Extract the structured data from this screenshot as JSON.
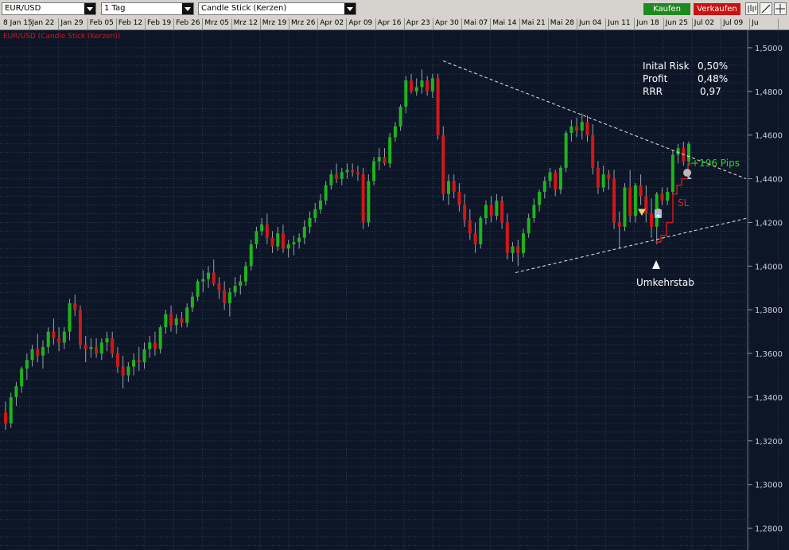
{
  "toolbar": {
    "symbol": "EUR/USD",
    "timeframe": "1 Tag",
    "chart_type": "Candle Stick (Kerzen)",
    "buy_label": "Kaufen",
    "sell_label": "Verkaufen",
    "buy_color": "#1f8a1f",
    "sell_color": "#cc1111",
    "tools": [
      "bar-chart-icon",
      "line-draw-icon",
      "crosshair-icon"
    ]
  },
  "date_axis": [
    "8 Jan 15",
    "Jan 22",
    "Jan 29",
    "Feb 05",
    "Feb 12",
    "Feb 19",
    "Feb 26",
    "Mrz 05",
    "Mrz 12",
    "Mrz 19",
    "Mrz 26",
    "Apr 02",
    "Apr 09",
    "Apr 16",
    "Apr 23",
    "Apr 30",
    "Mai 07",
    "Mai 14",
    "Mai 21",
    "Mai 28",
    "Jun 04",
    "Jun 11",
    "Jun 18",
    "Jun 25",
    "Jul 02",
    "Jul 09",
    "Ju"
  ],
  "chart_data": {
    "type": "candlestick",
    "legend": "EUR/USD (Candle Stick (Kerzen))",
    "y_ticks": [
      "1,5000",
      "1,4800",
      "1,4600",
      "1,4400",
      "1,4200",
      "1,4000",
      "1,3800",
      "1,3600",
      "1,3400",
      "1,3200",
      "1,3000",
      "1,2800"
    ],
    "ylim": [
      1.27,
      1.508
    ],
    "grid": true,
    "colors": {
      "up": "#1cb51c",
      "down": "#d01818",
      "background": "#0d1627",
      "grid": "#2e3a55"
    },
    "candles": [
      [
        1.333,
        1.338,
        1.325,
        1.328
      ],
      [
        1.328,
        1.342,
        1.326,
        1.34
      ],
      [
        1.34,
        1.347,
        1.336,
        1.345
      ],
      [
        1.345,
        1.354,
        1.342,
        1.353
      ],
      [
        1.353,
        1.36,
        1.348,
        1.357
      ],
      [
        1.357,
        1.364,
        1.354,
        1.362
      ],
      [
        1.362,
        1.369,
        1.356,
        1.359
      ],
      [
        1.359,
        1.366,
        1.353,
        1.363
      ],
      [
        1.363,
        1.372,
        1.36,
        1.37
      ],
      [
        1.37,
        1.376,
        1.364,
        1.367
      ],
      [
        1.367,
        1.372,
        1.361,
        1.365
      ],
      [
        1.365,
        1.372,
        1.362,
        1.37
      ],
      [
        1.37,
        1.385,
        1.366,
        1.383
      ],
      [
        1.383,
        1.387,
        1.377,
        1.38
      ],
      [
        1.38,
        1.382,
        1.362,
        1.364
      ],
      [
        1.364,
        1.368,
        1.356,
        1.362
      ],
      [
        1.362,
        1.367,
        1.358,
        1.363
      ],
      [
        1.363,
        1.367,
        1.358,
        1.36
      ],
      [
        1.36,
        1.367,
        1.357,
        1.365
      ],
      [
        1.365,
        1.37,
        1.361,
        1.367
      ],
      [
        1.367,
        1.37,
        1.358,
        1.36
      ],
      [
        1.36,
        1.363,
        1.351,
        1.354
      ],
      [
        1.354,
        1.359,
        1.344,
        1.35
      ],
      [
        1.35,
        1.356,
        1.347,
        1.354
      ],
      [
        1.354,
        1.36,
        1.35,
        1.357
      ],
      [
        1.357,
        1.363,
        1.352,
        1.356
      ],
      [
        1.356,
        1.365,
        1.353,
        1.362
      ],
      [
        1.362,
        1.368,
        1.358,
        1.365
      ],
      [
        1.365,
        1.37,
        1.359,
        1.362
      ],
      [
        1.362,
        1.373,
        1.36,
        1.372
      ],
      [
        1.372,
        1.38,
        1.369,
        1.378
      ],
      [
        1.378,
        1.382,
        1.37,
        1.373
      ],
      [
        1.373,
        1.378,
        1.369,
        1.376
      ],
      [
        1.376,
        1.379,
        1.372,
        1.374
      ],
      [
        1.374,
        1.383,
        1.372,
        1.381
      ],
      [
        1.381,
        1.388,
        1.379,
        1.386
      ],
      [
        1.386,
        1.394,
        1.384,
        1.393
      ],
      [
        1.393,
        1.398,
        1.388,
        1.394
      ],
      [
        1.394,
        1.4,
        1.39,
        1.397
      ],
      [
        1.397,
        1.403,
        1.391,
        1.392
      ],
      [
        1.392,
        1.395,
        1.385,
        1.389
      ],
      [
        1.389,
        1.393,
        1.38,
        1.383
      ],
      [
        1.383,
        1.39,
        1.377,
        1.388
      ],
      [
        1.388,
        1.395,
        1.386,
        1.391
      ],
      [
        1.391,
        1.396,
        1.387,
        1.393
      ],
      [
        1.393,
        1.402,
        1.391,
        1.4
      ],
      [
        1.4,
        1.412,
        1.398,
        1.41
      ],
      [
        1.41,
        1.418,
        1.408,
        1.416
      ],
      [
        1.416,
        1.422,
        1.414,
        1.419
      ],
      [
        1.419,
        1.424,
        1.41,
        1.413
      ],
      [
        1.413,
        1.416,
        1.406,
        1.409
      ],
      [
        1.409,
        1.418,
        1.407,
        1.415
      ],
      [
        1.415,
        1.419,
        1.406,
        1.408
      ],
      [
        1.408,
        1.412,
        1.404,
        1.41
      ],
      [
        1.41,
        1.414,
        1.405,
        1.411
      ],
      [
        1.411,
        1.415,
        1.408,
        1.413
      ],
      [
        1.413,
        1.421,
        1.41,
        1.418
      ],
      [
        1.418,
        1.425,
        1.415,
        1.422
      ],
      [
        1.422,
        1.429,
        1.42,
        1.426
      ],
      [
        1.426,
        1.433,
        1.424,
        1.43
      ],
      [
        1.43,
        1.439,
        1.428,
        1.437
      ],
      [
        1.437,
        1.444,
        1.435,
        1.442
      ],
      [
        1.442,
        1.447,
        1.438,
        1.44
      ],
      [
        1.44,
        1.445,
        1.437,
        1.443
      ],
      [
        1.443,
        1.447,
        1.44,
        1.444
      ],
      [
        1.444,
        1.447,
        1.441,
        1.443
      ],
      [
        1.443,
        1.446,
        1.439,
        1.442
      ],
      [
        1.442,
        1.445,
        1.417,
        1.42
      ],
      [
        1.42,
        1.442,
        1.418,
        1.439
      ],
      [
        1.439,
        1.45,
        1.437,
        1.448
      ],
      [
        1.448,
        1.454,
        1.444,
        1.45
      ],
      [
        1.45,
        1.454,
        1.446,
        1.447
      ],
      [
        1.447,
        1.461,
        1.445,
        1.459
      ],
      [
        1.459,
        1.466,
        1.457,
        1.464
      ],
      [
        1.464,
        1.474,
        1.462,
        1.473
      ],
      [
        1.473,
        1.487,
        1.47,
        1.485
      ],
      [
        1.485,
        1.488,
        1.479,
        1.48
      ],
      [
        1.48,
        1.486,
        1.478,
        1.482
      ],
      [
        1.482,
        1.49,
        1.479,
        1.485
      ],
      [
        1.485,
        1.487,
        1.478,
        1.48
      ],
      [
        1.48,
        1.488,
        1.477,
        1.486
      ],
      [
        1.486,
        1.488,
        1.458,
        1.46
      ],
      [
        1.46,
        1.464,
        1.43,
        1.433
      ],
      [
        1.433,
        1.442,
        1.428,
        1.439
      ],
      [
        1.439,
        1.442,
        1.431,
        1.434
      ],
      [
        1.434,
        1.438,
        1.425,
        1.428
      ],
      [
        1.428,
        1.433,
        1.418,
        1.421
      ],
      [
        1.421,
        1.426,
        1.412,
        1.415
      ],
      [
        1.415,
        1.42,
        1.406,
        1.41
      ],
      [
        1.41,
        1.423,
        1.408,
        1.422
      ],
      [
        1.422,
        1.43,
        1.419,
        1.428
      ],
      [
        1.428,
        1.432,
        1.42,
        1.423
      ],
      [
        1.423,
        1.433,
        1.421,
        1.43
      ],
      [
        1.43,
        1.432,
        1.417,
        1.42
      ],
      [
        1.42,
        1.424,
        1.403,
        1.406
      ],
      [
        1.406,
        1.411,
        1.402,
        1.409
      ],
      [
        1.409,
        1.412,
        1.4,
        1.406
      ],
      [
        1.406,
        1.417,
        1.404,
        1.415
      ],
      [
        1.415,
        1.424,
        1.413,
        1.422
      ],
      [
        1.422,
        1.431,
        1.42,
        1.428
      ],
      [
        1.428,
        1.435,
        1.425,
        1.434
      ],
      [
        1.434,
        1.441,
        1.431,
        1.439
      ],
      [
        1.439,
        1.445,
        1.436,
        1.443
      ],
      [
        1.443,
        1.444,
        1.432,
        1.435
      ],
      [
        1.435,
        1.446,
        1.433,
        1.445
      ],
      [
        1.445,
        1.462,
        1.443,
        1.461
      ],
      [
        1.461,
        1.467,
        1.457,
        1.464
      ],
      [
        1.464,
        1.468,
        1.459,
        1.462
      ],
      [
        1.462,
        1.47,
        1.458,
        1.466
      ],
      [
        1.466,
        1.469,
        1.457,
        1.46
      ],
      [
        1.46,
        1.465,
        1.442,
        1.445
      ],
      [
        1.445,
        1.448,
        1.433,
        1.436
      ],
      [
        1.436,
        1.446,
        1.434,
        1.442
      ],
      [
        1.442,
        1.444,
        1.435,
        1.44
      ],
      [
        1.44,
        1.444,
        1.417,
        1.42
      ],
      [
        1.42,
        1.425,
        1.408,
        1.418
      ],
      [
        1.418,
        1.438,
        1.416,
        1.436
      ],
      [
        1.436,
        1.444,
        1.42,
        1.423
      ],
      [
        1.423,
        1.438,
        1.42,
        1.437
      ],
      [
        1.437,
        1.442,
        1.428,
        1.432
      ],
      [
        1.432,
        1.437,
        1.42,
        1.424
      ],
      [
        1.424,
        1.431,
        1.413,
        1.418
      ],
      [
        1.418,
        1.434,
        1.41,
        1.433
      ],
      [
        1.433,
        1.436,
        1.428,
        1.43
      ],
      [
        1.43,
        1.436,
        1.428,
        1.434
      ],
      [
        1.434,
        1.453,
        1.432,
        1.451
      ],
      [
        1.451,
        1.456,
        1.447,
        1.454
      ],
      [
        1.454,
        1.457,
        1.446,
        1.448
      ],
      [
        1.448,
        1.457,
        1.446,
        1.456
      ]
    ]
  },
  "annotations": {
    "risk_labels": [
      "Inital Risk",
      "Profit",
      "RRR"
    ],
    "risk_values": [
      "0,50%",
      "0,48%",
      "0,97"
    ],
    "pips_label": "+196 Pips",
    "sl_label": "SL",
    "umkehrstab_label": "Umkehrstab",
    "upper_trendline": [
      [
        0,
        1.494
      ],
      [
        1,
        1.44
      ]
    ],
    "lower_trendline": [
      [
        0,
        1.397
      ],
      [
        1,
        1.422
      ]
    ],
    "stop_loss": [
      1.411,
      1.414,
      1.42,
      1.433,
      1.437,
      1.44,
      1.447
    ]
  }
}
